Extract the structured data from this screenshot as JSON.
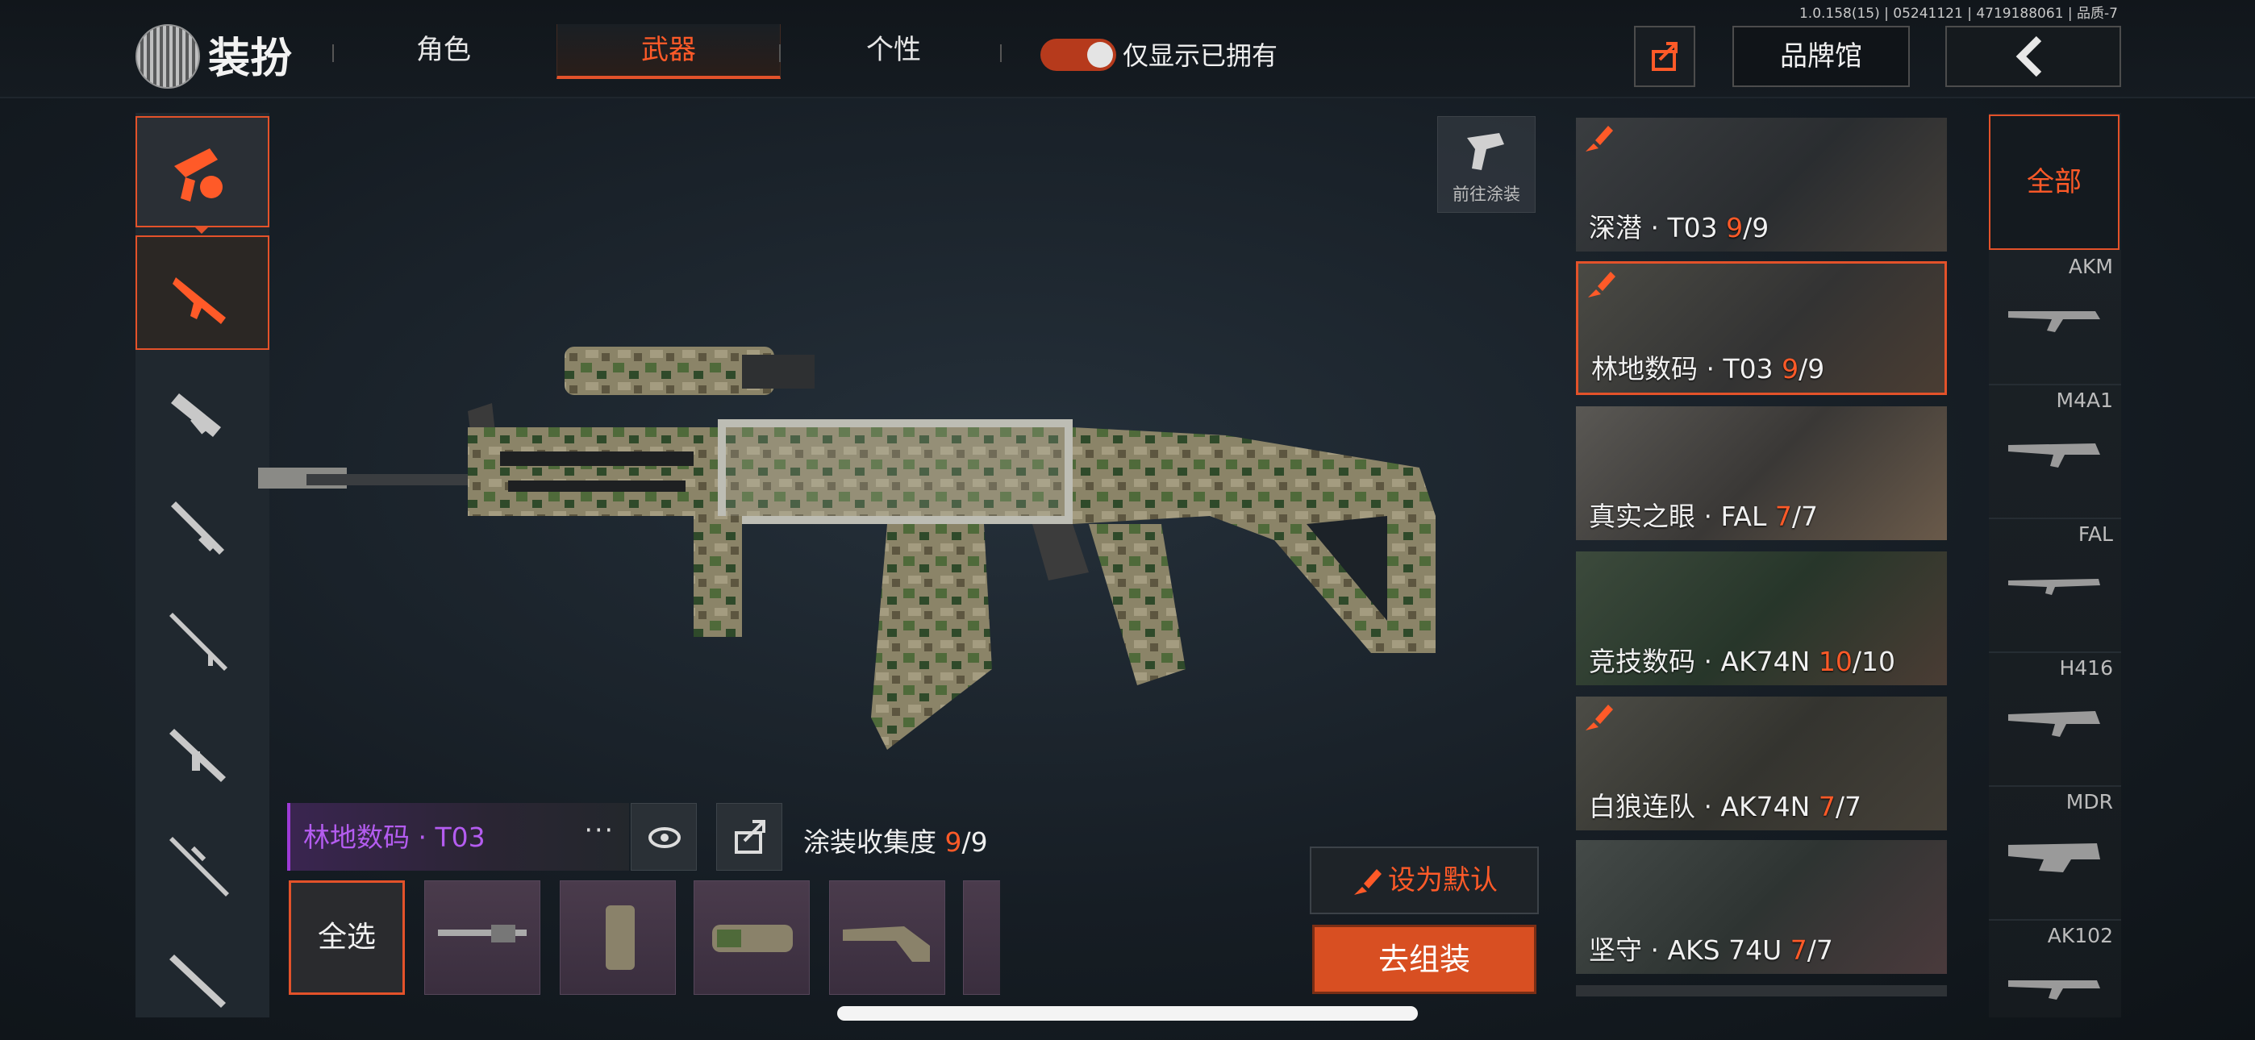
{
  "version": "1.0.158(15) | 05241121 | 4719188061 | 品质-7",
  "header": {
    "title": "装扮",
    "tabs": [
      {
        "label": "角色",
        "active": false
      },
      {
        "label": "武器",
        "active": true
      },
      {
        "label": "个性",
        "active": false
      }
    ],
    "toggle": {
      "label": "仅显示已拥有",
      "on": true
    },
    "brand_button": "品牌馆"
  },
  "goto_paint": {
    "label": "前往涂装"
  },
  "skins": [
    {
      "name": "深潜 · T03",
      "owned": "9",
      "total": "/9",
      "selected": false
    },
    {
      "name": "林地数码 · T03",
      "owned": "9",
      "total": "/9",
      "selected": true
    },
    {
      "name": "真实之眼 · FAL",
      "owned": "7",
      "total": "/7",
      "selected": false
    },
    {
      "name": "竞技数码 · AK74N",
      "owned": "10",
      "total": "/10",
      "selected": false
    },
    {
      "name": "白狼连队 · AK74N",
      "owned": "7",
      "total": "/7",
      "selected": false
    },
    {
      "name": "坚守 · AKS 74U",
      "owned": "7",
      "total": "/7",
      "selected": false
    }
  ],
  "weapon_filter": {
    "all_label": "全部",
    "types": [
      "AKM",
      "M4A1",
      "FAL",
      "H416",
      "MDR",
      "AK102"
    ]
  },
  "current": {
    "name": "林地数码 · T03",
    "more": "···",
    "collection_label": "涂装收集度 ",
    "collection_owned": "9",
    "collection_total": "/9"
  },
  "parts": {
    "select_all": "全选"
  },
  "actions": {
    "set_default": "设为默认",
    "assemble": "去组装"
  },
  "colors": {
    "accent": "#e3522a",
    "rarity_purple": "#9d3bd6"
  }
}
